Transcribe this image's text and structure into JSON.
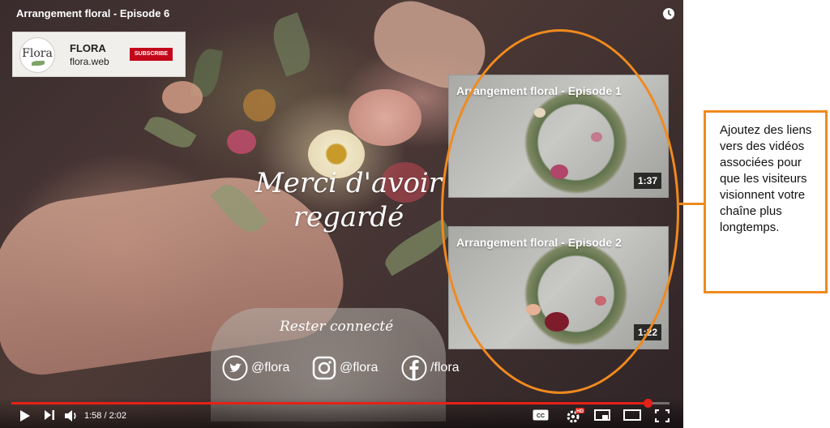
{
  "video": {
    "title": "Arrangement floral - Episode 6"
  },
  "channel": {
    "logo_text": "Flora",
    "name": "FLORA",
    "url": "flora.web",
    "subscribe_label": "SUBSCRIBE"
  },
  "end_screen": {
    "thanks_text": "Merci d'avoir regardé",
    "stay_connected": "Rester connecté",
    "socials": [
      {
        "icon": "twitter-icon",
        "handle": "@flora"
      },
      {
        "icon": "instagram-icon",
        "handle": "@flora"
      },
      {
        "icon": "facebook-icon",
        "handle": "/flora"
      }
    ],
    "cards": [
      {
        "title": "Arrangement floral - Episode 1",
        "duration": "1:37"
      },
      {
        "title": "Arrangement floral - Episode 2",
        "duration": "1:22"
      }
    ]
  },
  "callout": {
    "text": "Ajoutez des liens vers des vidéos associées pour que les visiteurs visionnent votre chaîne plus longtemps.",
    "accent_color": "#f08a1e"
  },
  "controls": {
    "current_time": "1:58",
    "duration": "2:02",
    "time_display": "1:58 / 2:02",
    "progress_fraction": 0.967,
    "progress_color": "#e62117",
    "buttons": [
      "play-icon",
      "next-icon",
      "volume-icon",
      "captions-icon",
      "settings-hd-icon",
      "miniplayer-icon",
      "theater-icon",
      "fullscreen-icon"
    ]
  }
}
